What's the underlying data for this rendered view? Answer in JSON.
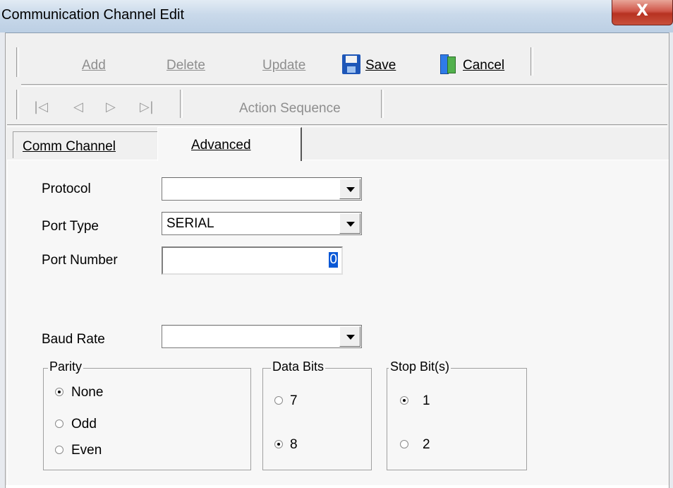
{
  "window": {
    "title": "Communication Channel Edit",
    "close_glyph": "X"
  },
  "toolbar": {
    "add_label": "Add",
    "delete_label": "Delete",
    "update_label": "Update",
    "save_label": "Save",
    "cancel_label": "Cancel",
    "nav": {
      "first": "|◁",
      "prev": "◁",
      "next": "▷",
      "last": "▷|"
    },
    "action_sequence_label": "Action Sequence"
  },
  "tabs": [
    {
      "label": "Comm Channel",
      "active": false
    },
    {
      "label": "Advanced",
      "active": true
    }
  ],
  "form": {
    "protocol": {
      "label": "Protocol",
      "value": ""
    },
    "port_type": {
      "label": "Port Type",
      "value": "SERIAL"
    },
    "port_number": {
      "label": "Port Number",
      "value": "0"
    },
    "baud_rate": {
      "label": "Baud Rate",
      "value": ""
    }
  },
  "parity": {
    "legend": "Parity",
    "options": [
      "None",
      "Odd",
      "Even"
    ],
    "selected": "None"
  },
  "data_bits": {
    "legend": "Data Bits",
    "options": [
      "7",
      "8"
    ],
    "selected": "8"
  },
  "stop_bits": {
    "legend": "Stop Bit(s)",
    "options": [
      "1",
      "2"
    ],
    "selected": "1"
  },
  "icons": {
    "save": "floppy-disk-icon",
    "cancel": "exit-door-icon",
    "dropdown": "chevron-down-icon"
  },
  "colors": {
    "selection": "#0a58d6",
    "close_button": "#c9513c",
    "disabled_text": "#8e8e8e"
  }
}
